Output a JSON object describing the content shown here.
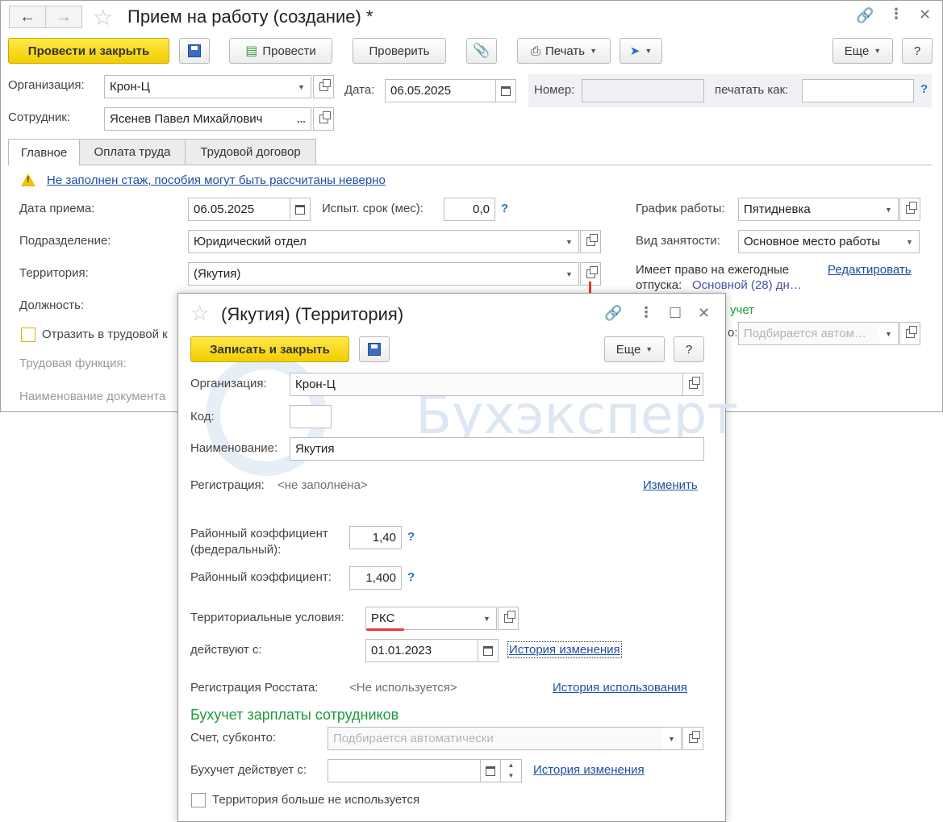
{
  "main": {
    "title": "Прием на работу (создание) *",
    "toolbar": {
      "post_close": "Провести и закрыть",
      "post": "Провести",
      "check": "Проверить",
      "print": "Печать",
      "more": "Еще",
      "help": "?"
    },
    "org_label": "Организация:",
    "org_value": "Крон-Ц",
    "date_label": "Дата:",
    "date_value": "06.05.2025",
    "number_label": "Номер:",
    "number_value": "",
    "print_as_label": "печатать как:",
    "print_as_value": "",
    "help_q": "?",
    "employee_label": "Сотрудник:",
    "employee_value": "Ясенев Павел Михайлович",
    "ellipsis": "...",
    "tabs": [
      {
        "label": "Главное"
      },
      {
        "label": "Оплата труда"
      },
      {
        "label": "Трудовой договор"
      }
    ],
    "warning": "Не заполнен стаж, пособия могут быть рассчитаны неверно",
    "hire_date_label": "Дата приема:",
    "hire_date_value": "06.05.2025",
    "probation_label": "Испыт. срок (мес):",
    "probation_value": "0,0",
    "department_label": "Подразделение:",
    "department_value": "Юридический отдел",
    "territory_label": "Территория:",
    "territory_value": "(Якутия)",
    "position_label": "Должность:",
    "reflect_label": "Отразить в трудовой к",
    "labor_function_label": "Трудовая функция:",
    "doc_name_label": "Наименование документа",
    "schedule_label": "График работы:",
    "schedule_value": "Пятидневка",
    "employment_label": "Вид занятости:",
    "employment_value": "Основное место работы",
    "vacation_label_1": "Имеет право на ежегодные",
    "vacation_label_2": "отпуска:",
    "vacation_value": "Основной (28) дн…",
    "edit_link": "Редактировать",
    "accounting_partial": "учет",
    "account_partial_label": "о:",
    "account_placeholder": "Подбирается автом…"
  },
  "dialog": {
    "title": "(Якутия) (Территория)",
    "save_close": "Записать и закрыть",
    "more": "Еще",
    "help": "?",
    "org_label": "Организация:",
    "org_value": "Крон-Ц",
    "code_label": "Код:",
    "code_value": "",
    "name_label": "Наименование:",
    "name_value": "Якутия",
    "registration_label": "Регистрация:",
    "registration_value": "<не заполнена>",
    "change_link": "Изменить",
    "coef_federal_label_1": "Районный коэффициент",
    "coef_federal_label_2": "(федеральный):",
    "coef_federal_value": "1,40",
    "coef_label": "Районный коэффициент:",
    "coef_value": "1,400",
    "q": "?",
    "conditions_label": "Территориальные условия:",
    "conditions_value": "РКС",
    "effective_label": "действуют с:",
    "effective_value": "01.01.2023",
    "history_change_link": "История изменения",
    "rosstat_label": "Регистрация Росстата:",
    "rosstat_value": "<Не используется>",
    "history_use_link": "История использования",
    "payroll_section": "Бухучет зарплаты сотрудников",
    "account_label": "Счет, субконто:",
    "account_placeholder": "Подбирается автоматически",
    "acc_effective_label": "Бухучет действует с:",
    "acc_effective_value": "",
    "acc_history_link": "История изменения",
    "not_used_label": "Территория больше не используется"
  },
  "watermark": "Бухэксперт",
  "colors": {
    "accent_yellow": "#f1cd00",
    "link_blue": "#1f4fa3",
    "section_green": "#1e9a3a",
    "annotation_red": "#e53935"
  }
}
